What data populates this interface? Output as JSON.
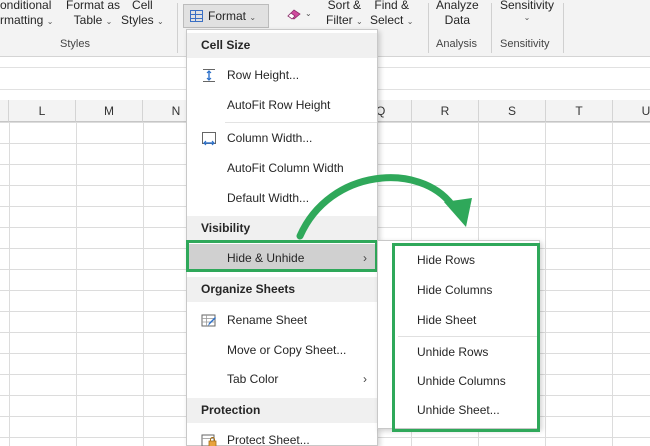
{
  "ribbon": {
    "conditional_formatting": [
      "onditional",
      "rmatting"
    ],
    "format_as_table": [
      "Format as",
      "Table"
    ],
    "cell_styles": [
      "Cell",
      "Styles"
    ],
    "styles_group": "Styles",
    "format_button": "Format",
    "sort_filter": [
      "Sort &",
      "Filter"
    ],
    "find_select": [
      "Find &",
      "Select"
    ],
    "analyze_data": [
      "Analyze",
      "Data"
    ],
    "analysis_group": "Analysis",
    "sensitivity": "Sensitivity",
    "sensitivity_group": "Sensitivity"
  },
  "columns": [
    "L",
    "M",
    "N",
    "Q",
    "R",
    "S",
    "T",
    "U"
  ],
  "menu": {
    "cell_size_header": "Cell Size",
    "row_height": "Row Height...",
    "autofit_row_height": "AutoFit Row Height",
    "column_width": "Column Width...",
    "autofit_column_width": "AutoFit Column Width",
    "default_width": "Default Width...",
    "visibility_header": "Visibility",
    "hide_unhide": "Hide & Unhide",
    "organize_header": "Organize Sheets",
    "rename_sheet": "Rename Sheet",
    "move_copy": "Move or Copy Sheet...",
    "tab_color": "Tab Color",
    "protection_header": "Protection",
    "protect_sheet": "Protect Sheet..."
  },
  "submenu": {
    "hide_rows": "Hide Rows",
    "hide_columns": "Hide Columns",
    "hide_sheet": "Hide Sheet",
    "unhide_rows": "Unhide Rows",
    "unhide_columns": "Unhide Columns",
    "unhide_sheet": "Unhide Sheet..."
  },
  "colors": {
    "highlight_green": "#2fa85a",
    "selected_item": "#d0d0d0",
    "section_bg": "#f0f0f0"
  },
  "icons": {
    "submenu_arrow": "›"
  }
}
